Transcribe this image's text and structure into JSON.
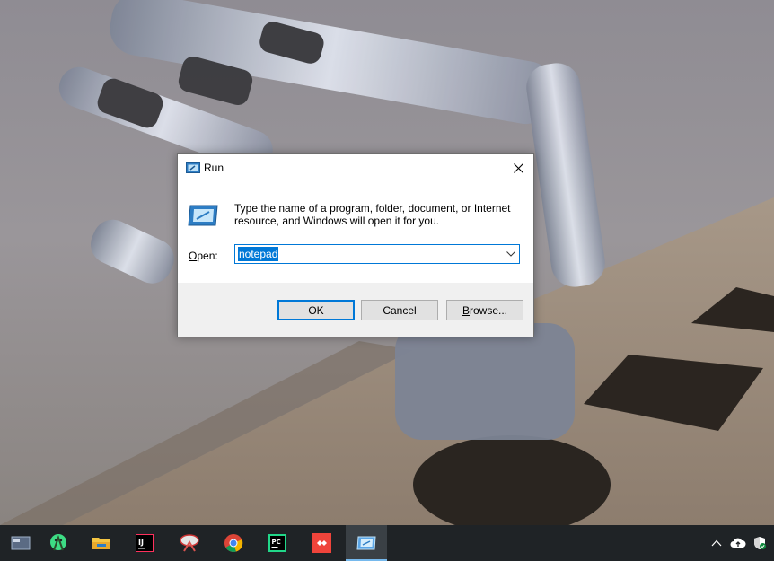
{
  "dialog": {
    "title": "Run",
    "description": "Type the name of a program, folder, document, or Internet resource, and Windows will open it for you.",
    "open_label_accel": "O",
    "open_label_rest": "pen:",
    "open_value": "notepad",
    "ok_label": "OK",
    "cancel_label": "Cancel",
    "browse_accel": "B",
    "browse_rest": "rowse...",
    "icons": {
      "title": "run-icon",
      "main": "run-icon",
      "close": "close-icon",
      "dropdown": "chevron-down-icon"
    }
  },
  "taskbar": {
    "apps": [
      {
        "name": "task-view-icon"
      },
      {
        "name": "android-studio-icon"
      },
      {
        "name": "file-explorer-icon"
      },
      {
        "name": "intellij-idea-icon"
      },
      {
        "name": "snipping-tool-icon"
      },
      {
        "name": "chrome-icon"
      },
      {
        "name": "pycharm-icon"
      },
      {
        "name": "anydesk-icon"
      },
      {
        "name": "run-app-icon",
        "active": true
      }
    ],
    "tray": [
      "chevron-up-icon",
      "onedrive-icon",
      "windows-security-icon"
    ]
  },
  "colors": {
    "accent": "#0078d7",
    "taskbar": "#1f2326",
    "button_face": "#e1e1e1",
    "footer": "#f0f0f0"
  }
}
